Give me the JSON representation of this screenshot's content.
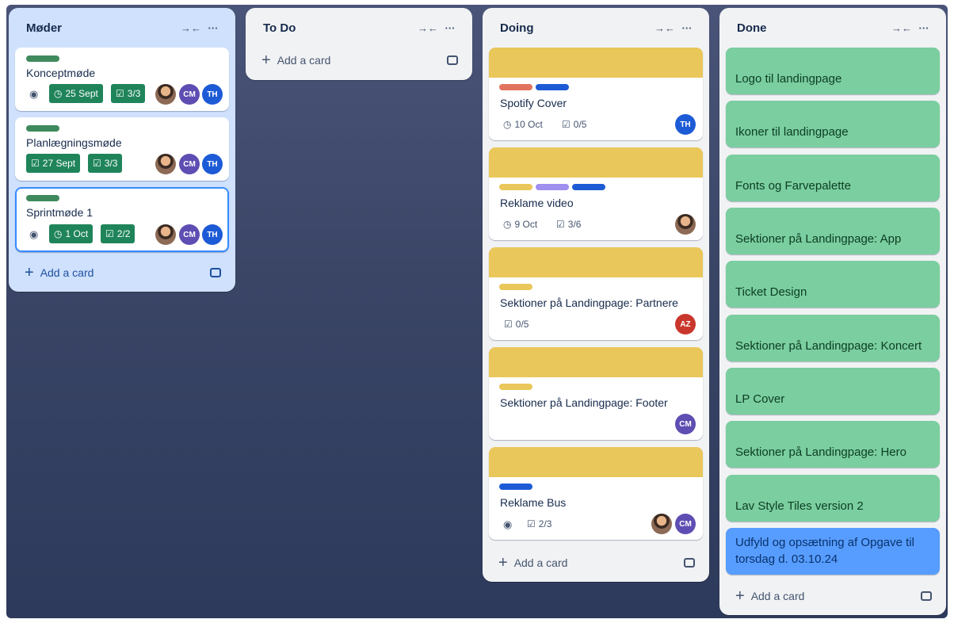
{
  "lists": [
    {
      "title": "Møder",
      "add_label": "Add a card",
      "cards": [
        {
          "title": "Konceptmøde",
          "due": "25 Sept",
          "checklist": "3/3",
          "members": [
            "CM",
            "TH"
          ]
        },
        {
          "title": "Planlægningsmøde",
          "due": "27 Sept",
          "checklist": "3/3",
          "members": [
            "CM",
            "TH"
          ]
        },
        {
          "title": "Sprintmøde 1",
          "due": "1 Oct",
          "checklist": "2/2",
          "members": [
            "CM",
            "TH"
          ]
        }
      ]
    },
    {
      "title": "To Do",
      "add_label": "Add a card",
      "cards": []
    },
    {
      "title": "Doing",
      "add_label": "Add a card",
      "cards": [
        {
          "title": "Spotify Cover",
          "due": "10 Oct",
          "checklist": "0/5",
          "members": [
            "TH"
          ]
        },
        {
          "title": "Reklame video",
          "due": "9 Oct",
          "checklist": "3/6",
          "members": []
        },
        {
          "title": "Sektioner på Landingpage: Partnere",
          "checklist": "0/5",
          "members": [
            "AZ"
          ]
        },
        {
          "title": "Sektioner på Landingpage: Footer",
          "members": [
            "CM"
          ]
        },
        {
          "title": "Reklame Bus",
          "checklist": "2/3",
          "members": [
            "CM"
          ]
        }
      ]
    },
    {
      "title": "Done",
      "add_label": "Add a card",
      "cards": [
        {
          "title": "Logo til landingpage"
        },
        {
          "title": "Ikoner til landingpage"
        },
        {
          "title": "Fonts og Farvepalette"
        },
        {
          "title": "Sektioner på Landingpage: App"
        },
        {
          "title": "Ticket Design"
        },
        {
          "title": "Sektioner på Landingpage: Koncert"
        },
        {
          "title": "LP Cover"
        },
        {
          "title": "Sektioner på Landingpage: Hero"
        },
        {
          "title": "Lav Style Tiles version 2"
        },
        {
          "title": "Udfyld og opsætning af Opgave til torsdag d. 03.10.24"
        }
      ]
    }
  ],
  "colors": {
    "label_green": "#4bce97",
    "label_red": "#e2745f",
    "label_blue": "#1d5bd6",
    "label_yellow": "#e9c75a",
    "label_purple": "#9f8fef",
    "due_complete": "#1f845a",
    "done_card": "#7ace9f",
    "done_card_highlight": "#579dff"
  },
  "icons": [
    "collapse-icon",
    "more-icon",
    "eye-icon",
    "clock-icon",
    "checklist-icon",
    "plus-icon",
    "template-icon"
  ]
}
